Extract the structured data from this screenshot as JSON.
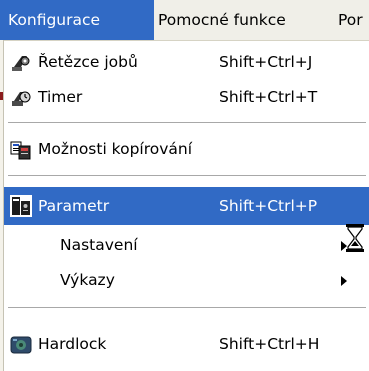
{
  "menubar": {
    "items": [
      {
        "label": "Konfigurace",
        "active": true
      },
      {
        "label": "Pomocné funkce",
        "active": false
      },
      {
        "label": "Por",
        "active": false
      }
    ]
  },
  "menu": {
    "items": [
      {
        "label": "Řetězce jobů",
        "shortcut": "Shift+Ctrl+J",
        "icon": "chain-jobs-icon"
      },
      {
        "label": "Timer",
        "shortcut": "Shift+Ctrl+T",
        "icon": "timer-icon"
      },
      {
        "label": "Možnosti kopírování",
        "shortcut": "",
        "icon": "copy-options-icon"
      },
      {
        "label": "Parametr",
        "shortcut": "Shift+Ctrl+P",
        "icon": "parameter-icon",
        "selected": true
      },
      {
        "label": "Nastavení",
        "shortcut": "",
        "icon": "",
        "submenu": true
      },
      {
        "label": "Výkazy",
        "shortcut": "",
        "icon": "",
        "submenu": true
      },
      {
        "label": "Hardlock",
        "shortcut": "Shift+Ctrl+H",
        "icon": "hardlock-icon"
      }
    ]
  },
  "colors": {
    "selection": "#316ac5",
    "menubar_bg": "#f0efe8",
    "separator": "#a8a8a8"
  },
  "cursor": "hourglass-cursor-icon"
}
